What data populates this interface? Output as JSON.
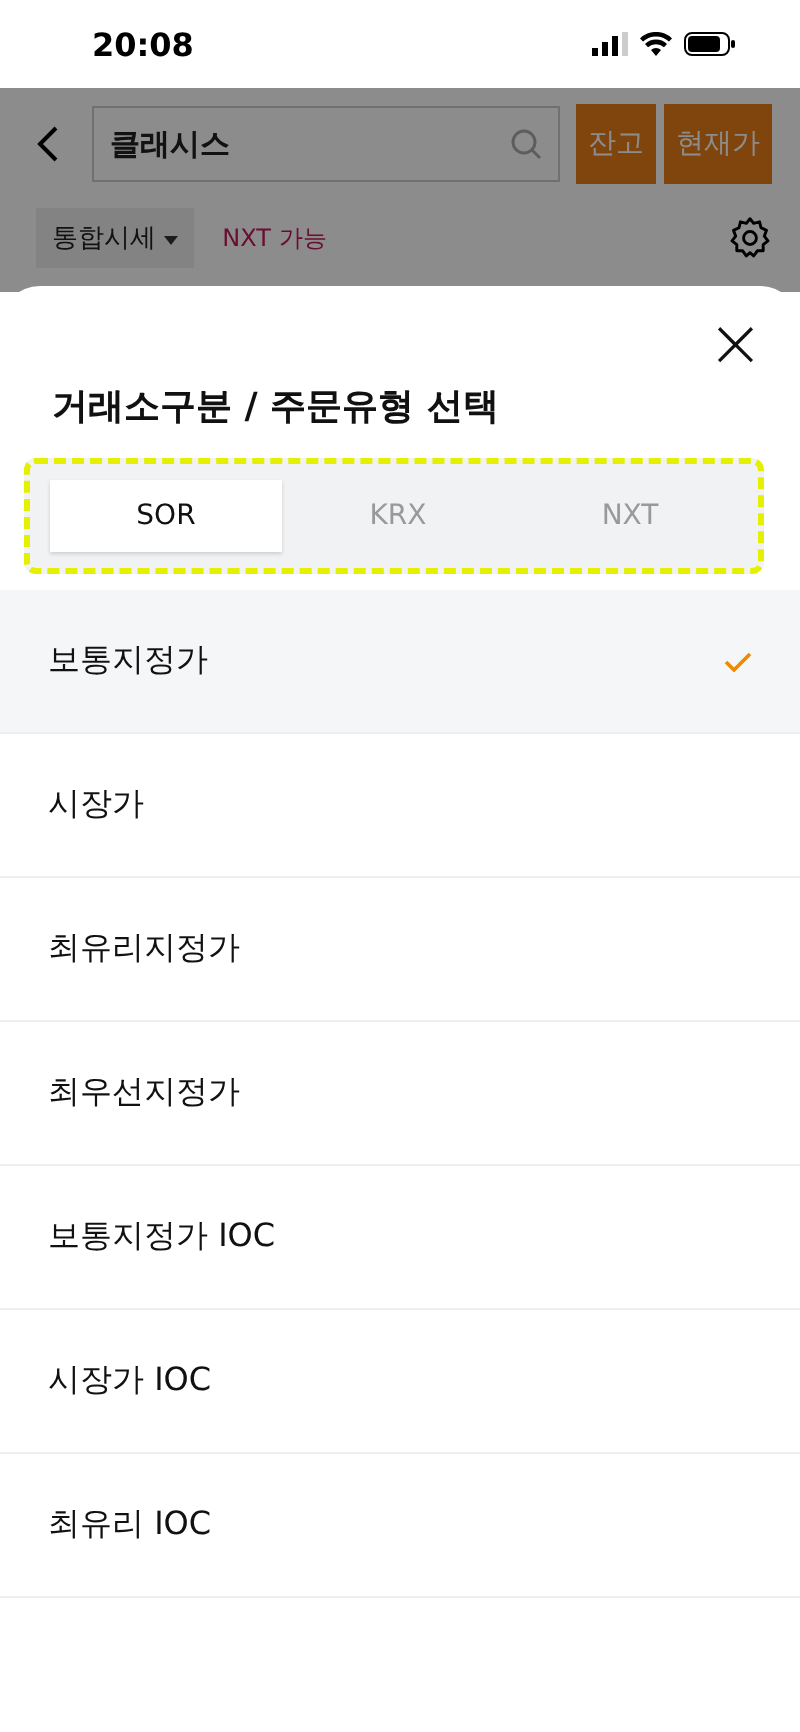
{
  "status_bar": {
    "time": "20:08"
  },
  "header": {
    "search": {
      "value": "클래시스"
    },
    "buttons": [
      "잔고",
      "현재가"
    ],
    "quote_mode": "통합시세",
    "nxt_badge": "NXT 가능"
  },
  "sheet": {
    "title": "거래소구분 / 주문유형 선택",
    "close": "×",
    "tabs": [
      {
        "label": "SOR",
        "selected": true
      },
      {
        "label": "KRX",
        "selected": false
      },
      {
        "label": "NXT",
        "selected": false
      }
    ],
    "options": [
      {
        "label": "보통지정가",
        "selected": true
      },
      {
        "label": "시장가",
        "selected": false
      },
      {
        "label": "최유리지정가",
        "selected": false
      },
      {
        "label": "최우선지정가",
        "selected": false
      },
      {
        "label": "보통지정가 IOC",
        "selected": false
      },
      {
        "label": "시장가 IOC",
        "selected": false
      },
      {
        "label": "최유리 IOC",
        "selected": false
      }
    ]
  }
}
